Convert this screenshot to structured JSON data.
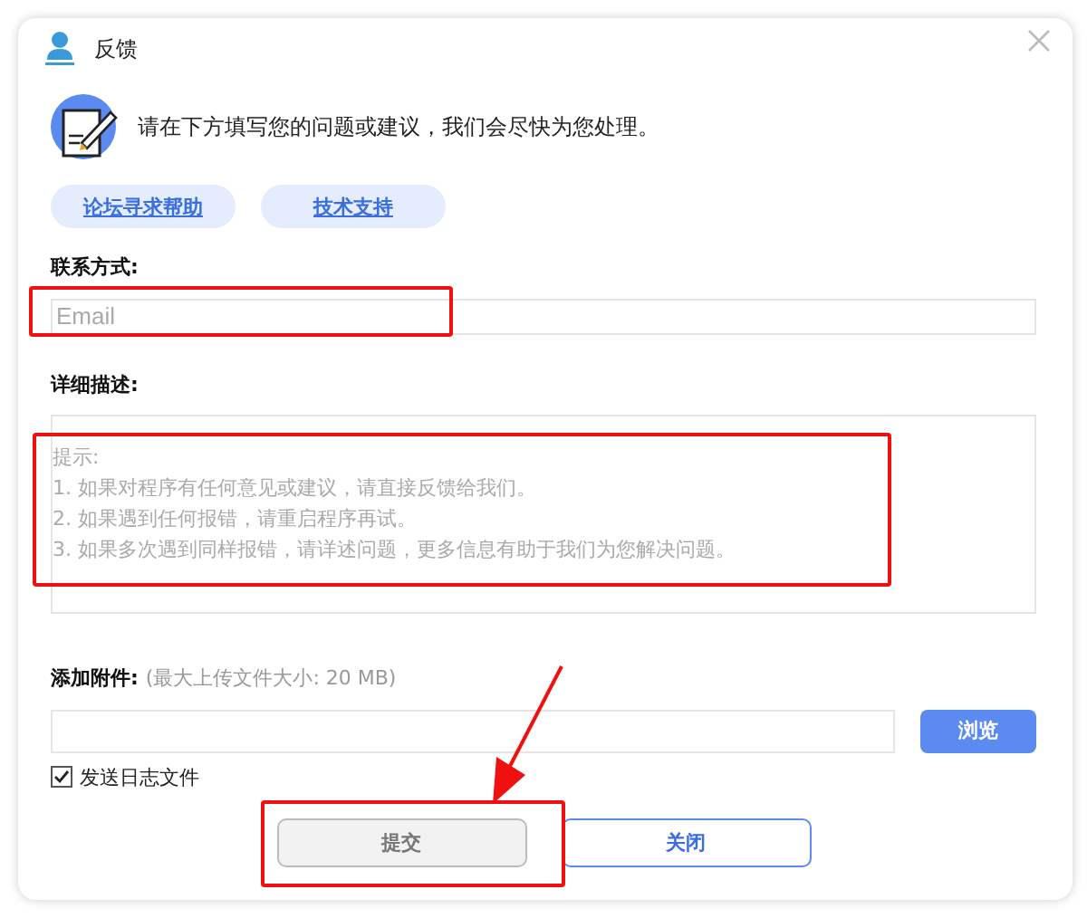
{
  "window": {
    "title": "反馈"
  },
  "intro": "请在下方填写您的问题或建议，我们会尽快为您处理。",
  "links": [
    {
      "label": "论坛寻求帮助"
    },
    {
      "label": "技术支持"
    }
  ],
  "contact": {
    "label": "联系方式:",
    "placeholder": "Email"
  },
  "description": {
    "label": "详细描述:",
    "placeholder": "提示:\n1. 如果对程序有任何意见或建议，请直接反馈给我们。\n2. 如果遇到任何报错，请重启程序再试。\n3. 如果多次遇到同样报错，请详述问题，更多信息有助于我们为您解决问题。"
  },
  "attachment": {
    "label": "添加附件:",
    "hint": "(最大上传文件大小: 20 MB)",
    "button": "浏览"
  },
  "send_log": {
    "label": "发送日志文件",
    "checked": true
  },
  "buttons": [
    {
      "label": "提交",
      "kind": "primary",
      "disabled": true
    },
    {
      "label": "关闭",
      "kind": "secondary",
      "disabled": false
    }
  ]
}
